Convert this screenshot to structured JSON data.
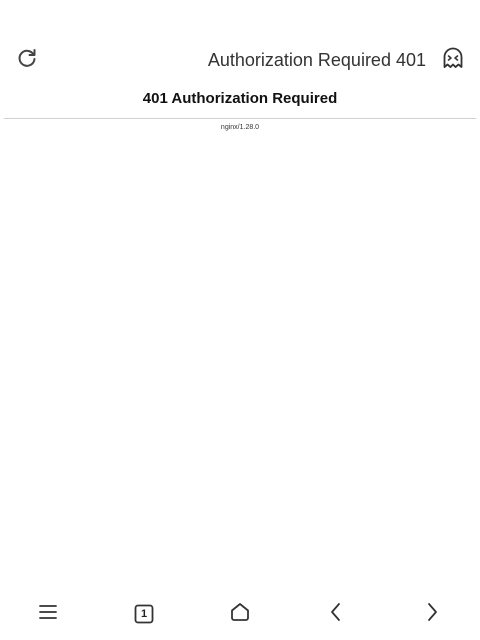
{
  "toolbar": {
    "title": "Authorization Required 401",
    "reload_icon": "reload-icon",
    "ghost_icon": "incognito-ghost-icon"
  },
  "page": {
    "heading": "401 Authorization Required",
    "server": "nginx/1.28.0"
  },
  "bottom_nav": {
    "menu_icon": "menu-icon",
    "tabs_count": "1",
    "home_icon": "home-icon",
    "back_icon": "back-icon",
    "forward_icon": "forward-icon"
  }
}
